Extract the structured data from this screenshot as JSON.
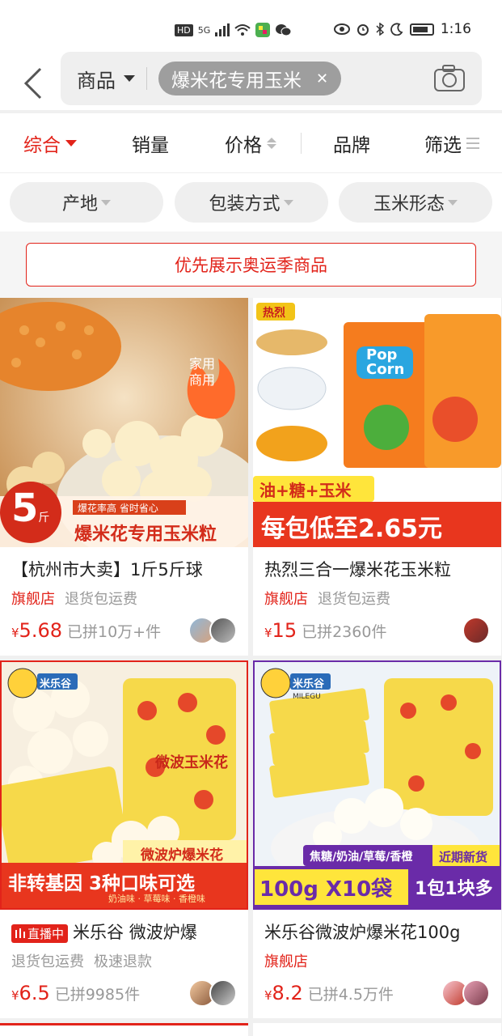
{
  "status": {
    "hd": "HD",
    "net": "5G",
    "time": "1:16"
  },
  "search": {
    "scope": "商品",
    "query": "爆米花专用玉米"
  },
  "sort": {
    "items": [
      "综合",
      "销量",
      "价格",
      "品牌",
      "筛选"
    ]
  },
  "filters": [
    "产地",
    "包装方式",
    "玉米形态"
  ],
  "olympic": "优先展示奥运季商品",
  "products": [
    {
      "title": "【杭州市大卖】1斤5斤球",
      "tags": [
        "旗舰店",
        "退货包运费"
      ],
      "currency": "¥",
      "price": "5.68",
      "sold": "已拼10万+件",
      "img": {
        "badge_top": "家用",
        "badge_bottom": "商用",
        "weight_num": "5",
        "weight_unit": "斤",
        "banner_small": "爆花率高 省时省心",
        "banner_big": "爆米花专用玉米粒"
      }
    },
    {
      "title": "热烈三合一爆米花玉米粒",
      "tags": [
        "旗舰店",
        "退货包运费"
      ],
      "currency": "¥",
      "price": "15",
      "sold": "已拼2360件",
      "img": {
        "brand": "热烈",
        "tag": "油+糖+玉米",
        "banner": "每包低至2.65元",
        "pack1": "Pop",
        "pack2": "Corn"
      }
    },
    {
      "title": "米乐谷 微波炉爆",
      "live": "直播中",
      "tags": [
        "退货包运费",
        "极速退款"
      ],
      "currency": "¥",
      "price": "6.5",
      "sold": "已拼9985件",
      "img": {
        "brand": "米乐谷",
        "tag": "微波炉爆米花",
        "banner": "非转基因 3种口味可选",
        "flavors": "奶油味 · 草莓味 · 香橙味",
        "bag": "微波玉米花"
      }
    },
    {
      "title": "米乐谷微波炉爆米花100g",
      "tags": [
        "旗舰店"
      ],
      "currency": "¥",
      "price": "8.2",
      "sold": "已拼4.5万件",
      "img": {
        "brand": "米乐谷",
        "sub": "MILEGU",
        "corner": "近期新货",
        "flavors": "焦糖/奶油/草莓/香橙",
        "banner_left": "100g X10袋",
        "banner_right": "1包1块多"
      }
    }
  ],
  "colors": {
    "accent": "#e2231a",
    "chip": "#9e9e9e"
  }
}
